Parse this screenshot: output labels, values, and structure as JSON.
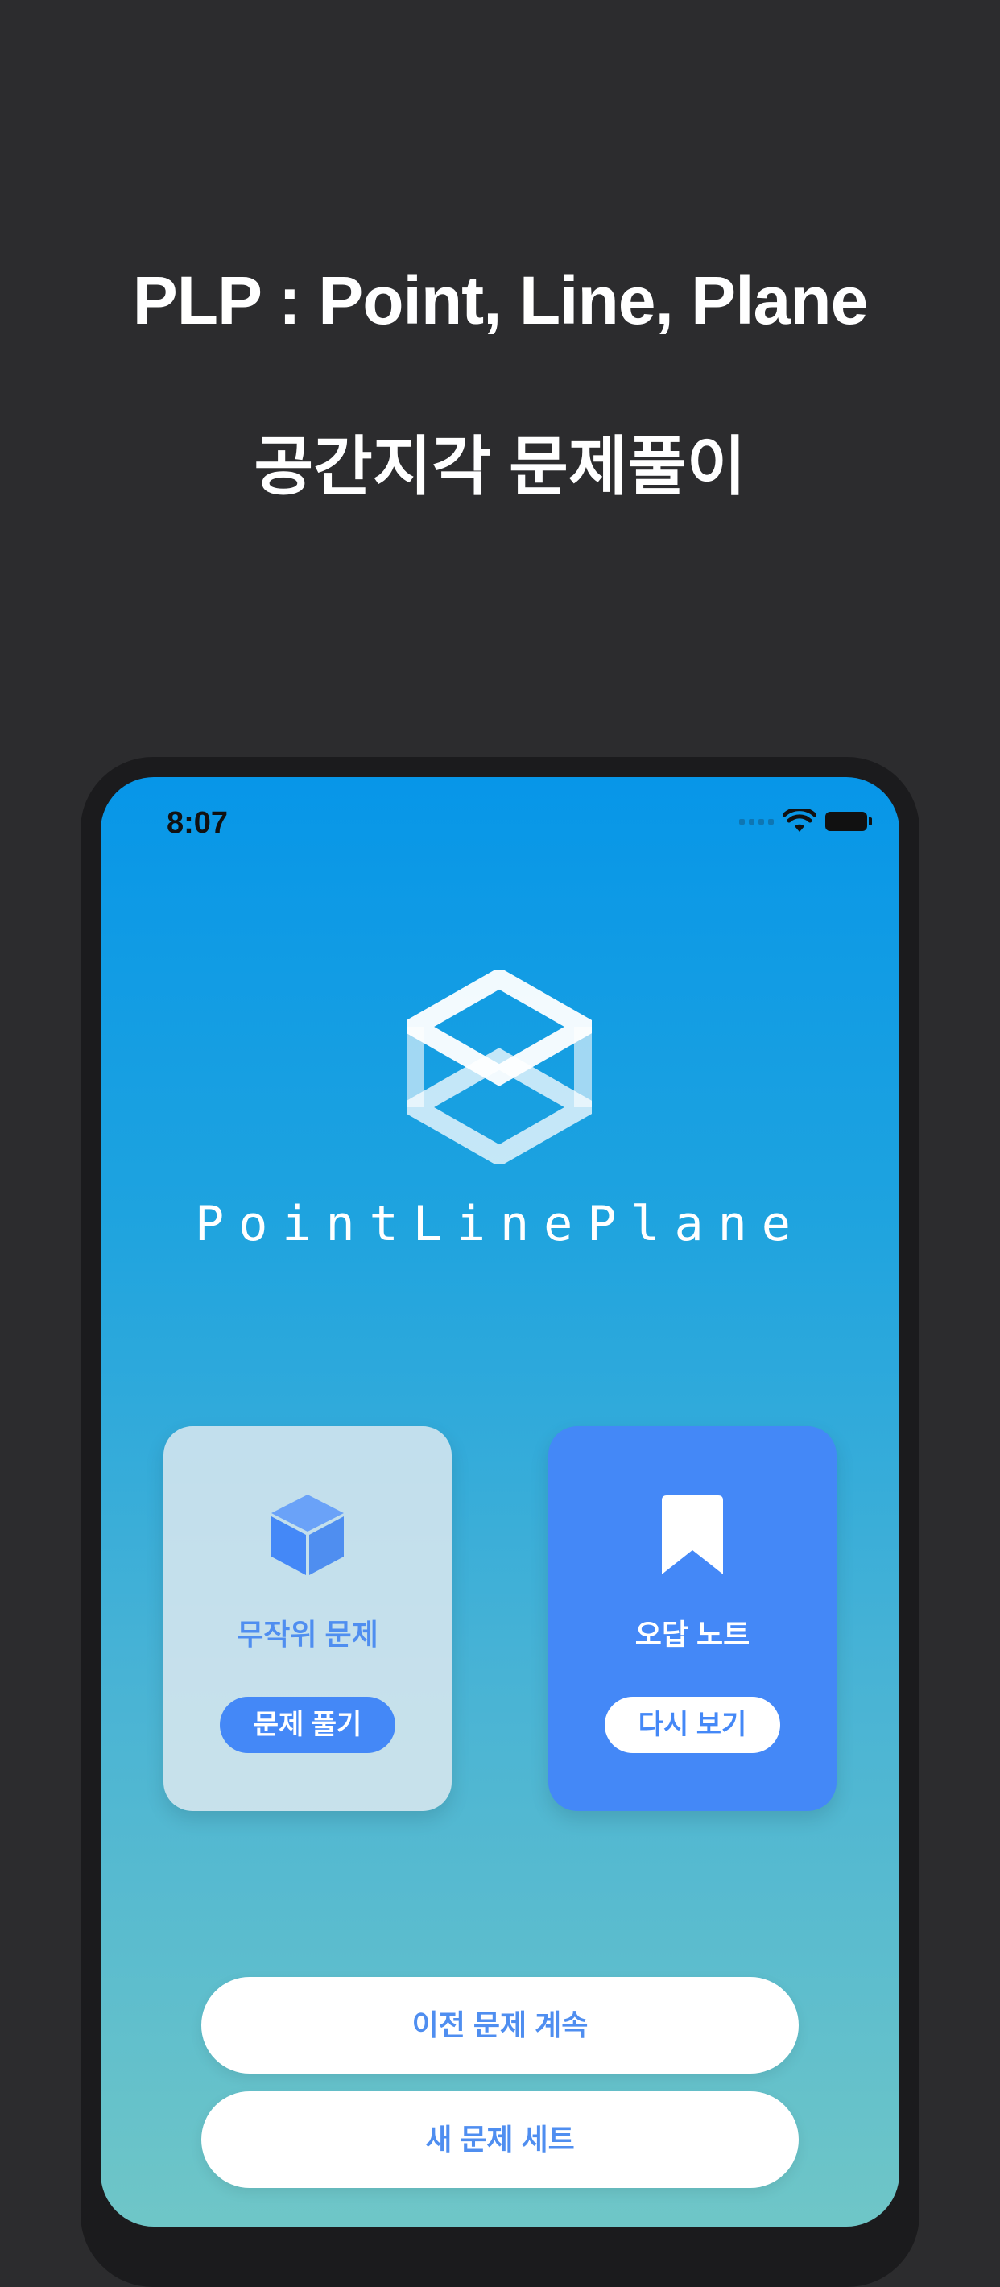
{
  "header": {
    "title": "PLP : Point, Line, Plane",
    "subtitle": "공간지각 문제풀이"
  },
  "status_bar": {
    "time": "8:07",
    "icons": [
      "signal-icon",
      "wifi-icon",
      "battery-icon"
    ]
  },
  "app": {
    "brand": "PointLinePlane",
    "logo_icon": "plp-logo-icon"
  },
  "cards": {
    "random": {
      "title": "무작위 문제",
      "button": "문제 풀기",
      "icon": "cube-icon"
    },
    "wrong_note": {
      "title": "오답 노트",
      "button": "다시 보기",
      "icon": "bookmark-icon"
    }
  },
  "buttons": {
    "continue_label": "이전 문제 계속",
    "new_set_label": "새 문제 세트"
  },
  "colors": {
    "page_bg": "#2c2c2e",
    "accent": "#4488f7",
    "gradient_top": "#0796e8",
    "gradient_bottom": "#6fc6c7"
  }
}
